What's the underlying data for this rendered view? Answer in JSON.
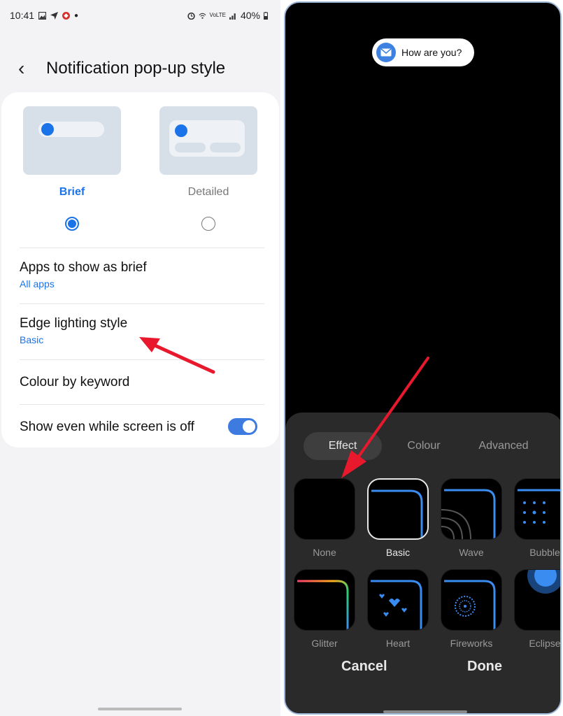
{
  "left": {
    "status": {
      "time": "10:41",
      "battery": "40%",
      "network": "VoLTE"
    },
    "title": "Notification pop-up style",
    "styles": [
      {
        "label": "Brief",
        "selected": true
      },
      {
        "label": "Detailed",
        "selected": false
      }
    ],
    "rows": [
      {
        "title": "Apps to show as brief",
        "sub": "All apps"
      },
      {
        "title": "Edge lighting style",
        "sub": "Basic"
      },
      {
        "title": "Colour by keyword"
      },
      {
        "title": "Show even while screen is off",
        "toggle": true
      }
    ]
  },
  "right": {
    "bubble_text": "How are you?",
    "tabs": [
      "Effect",
      "Colour",
      "Advanced"
    ],
    "active_tab": "Effect",
    "effects": [
      "None",
      "Basic",
      "Wave",
      "Bubble",
      "Glitter",
      "Heart",
      "Fireworks",
      "Eclipse"
    ],
    "selected_effect": "Basic",
    "cancel": "Cancel",
    "done": "Done"
  },
  "colors": {
    "accent": "#1a73e8",
    "edge_light": "#3a8cf0",
    "sheet_bg": "#2a2a2b",
    "arrow": "#e8192c"
  }
}
